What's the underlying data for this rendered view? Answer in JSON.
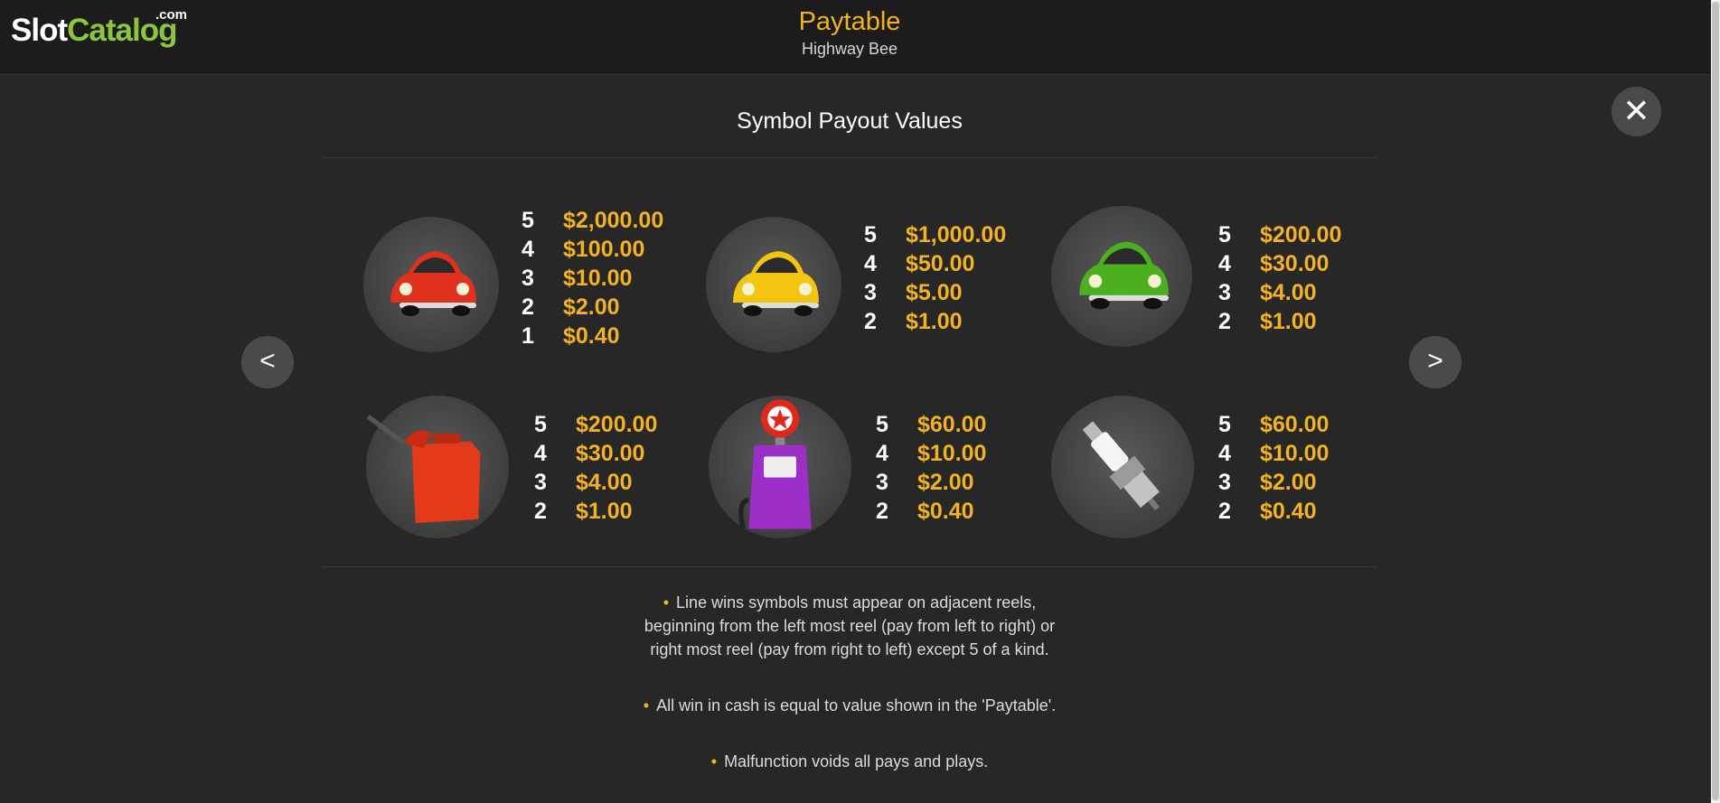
{
  "brand": {
    "slot": "Slot",
    "catalog": "Catalog",
    "com": ".com"
  },
  "header": {
    "title": "Paytable",
    "subtitle": "Highway Bee"
  },
  "section_title": "Symbol Payout Values",
  "nav": {
    "prev": "<",
    "next": ">",
    "close": "✕"
  },
  "symbols": [
    {
      "name": "red car",
      "pays": [
        {
          "count": "5",
          "value": "$2,000.00"
        },
        {
          "count": "4",
          "value": "$100.00"
        },
        {
          "count": "3",
          "value": "$10.00"
        },
        {
          "count": "2",
          "value": "$2.00"
        },
        {
          "count": "1",
          "value": "$0.40"
        }
      ]
    },
    {
      "name": "yellow car",
      "pays": [
        {
          "count": "5",
          "value": "$1,000.00"
        },
        {
          "count": "4",
          "value": "$50.00"
        },
        {
          "count": "3",
          "value": "$5.00"
        },
        {
          "count": "2",
          "value": "$1.00"
        }
      ]
    },
    {
      "name": "green car",
      "pays": [
        {
          "count": "5",
          "value": "$200.00"
        },
        {
          "count": "4",
          "value": "$30.00"
        },
        {
          "count": "3",
          "value": "$4.00"
        },
        {
          "count": "2",
          "value": "$1.00"
        }
      ]
    },
    {
      "name": "gas can",
      "pays": [
        {
          "count": "5",
          "value": "$200.00"
        },
        {
          "count": "4",
          "value": "$30.00"
        },
        {
          "count": "3",
          "value": "$4.00"
        },
        {
          "count": "2",
          "value": "$1.00"
        }
      ]
    },
    {
      "name": "gas pump",
      "pays": [
        {
          "count": "5",
          "value": "$60.00"
        },
        {
          "count": "4",
          "value": "$10.00"
        },
        {
          "count": "3",
          "value": "$2.00"
        },
        {
          "count": "2",
          "value": "$0.40"
        }
      ]
    },
    {
      "name": "spark plug",
      "pays": [
        {
          "count": "5",
          "value": "$60.00"
        },
        {
          "count": "4",
          "value": "$10.00"
        },
        {
          "count": "3",
          "value": "$2.00"
        },
        {
          "count": "2",
          "value": "$0.40"
        }
      ]
    }
  ],
  "rules": [
    {
      "lines": [
        "Line wins symbols must appear on adjacent reels,",
        "beginning from the left most reel (pay from left to right) or",
        "right most reel (pay from right to left) except 5 of a kind."
      ]
    },
    {
      "lines": [
        "All win in cash is equal to value shown in the 'Paytable'."
      ]
    },
    {
      "lines": [
        "Malfunction voids all pays and plays."
      ]
    }
  ],
  "colors": {
    "accent": "#f3b223",
    "brand_green": "#8cc63f",
    "background": "#272727",
    "header_bg": "#1c1c1c"
  }
}
